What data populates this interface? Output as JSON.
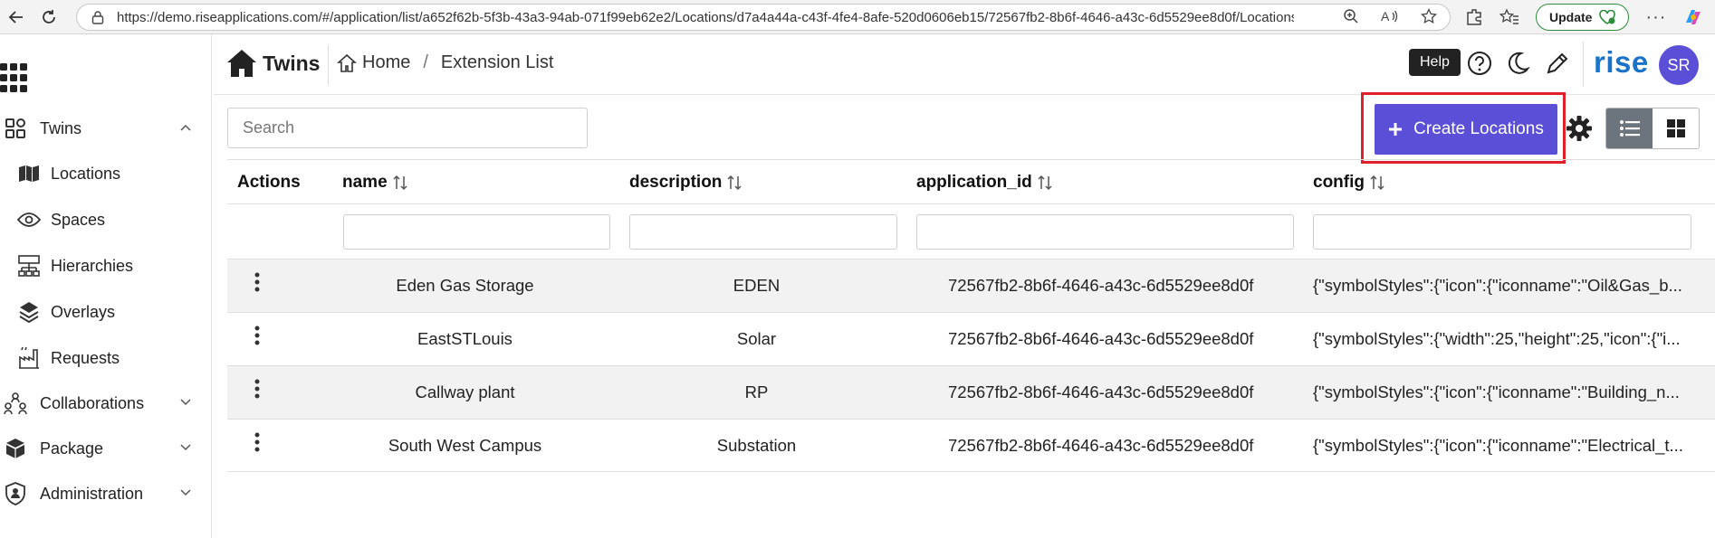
{
  "browser": {
    "url": "https://demo.riseapplications.com/#/application/list/a652f62b-5f3b-43a3-94ab-071f99eb62e2/Locations/d7a4a44a-c43f-4fe4-8afe-520d0606eb15/72567fb2-8b6f-4646-a43c-6d5529ee8d0f/Locations%...",
    "update_label": "Update"
  },
  "sidebar": {
    "items": [
      {
        "label": "Twins",
        "icon": "grid-squares-icon",
        "expandable": true,
        "expanded": true
      },
      {
        "label": "Locations",
        "icon": "map-icon"
      },
      {
        "label": "Spaces",
        "icon": "eye-icon"
      },
      {
        "label": "Hierarchies",
        "icon": "hierarchy-icon"
      },
      {
        "label": "Overlays",
        "icon": "layers-icon"
      },
      {
        "label": "Requests",
        "icon": "factory-icon"
      },
      {
        "label": "Collaborations",
        "icon": "people-icon",
        "expandable": true
      },
      {
        "label": "Package",
        "icon": "box-icon",
        "expandable": true
      },
      {
        "label": "Administration",
        "icon": "shield-user-icon",
        "expandable": true
      }
    ]
  },
  "header": {
    "app_title": "Twins",
    "breadcrumb": [
      "Home",
      "Extension List"
    ],
    "help_tooltip": "Help",
    "logo_text": "rise",
    "avatar_initials": "SR"
  },
  "toolbar": {
    "search_placeholder": "Search",
    "create_label": "Create Locations"
  },
  "table": {
    "columns": [
      "Actions",
      "name",
      "description",
      "application_id",
      "config"
    ],
    "rows": [
      {
        "name": "Eden Gas Storage",
        "description": "EDEN",
        "application_id": "72567fb2-8b6f-4646-a43c-6d5529ee8d0f",
        "config": "{\"symbolStyles\":{\"icon\":{\"iconname\":\"Oil&Gas_b..."
      },
      {
        "name": "EastSTLouis",
        "description": "Solar",
        "application_id": "72567fb2-8b6f-4646-a43c-6d5529ee8d0f",
        "config": "{\"symbolStyles\":{\"width\":25,\"height\":25,\"icon\":{\"i..."
      },
      {
        "name": "Callway plant",
        "description": "RP",
        "application_id": "72567fb2-8b6f-4646-a43c-6d5529ee8d0f",
        "config": "{\"symbolStyles\":{\"icon\":{\"iconname\":\"Building_n..."
      },
      {
        "name": "South West Campus",
        "description": "Substation",
        "application_id": "72567fb2-8b6f-4646-a43c-6d5529ee8d0f",
        "config": "{\"symbolStyles\":{\"icon\":{\"iconname\":\"Electrical_t..."
      }
    ]
  },
  "colors": {
    "accent": "#5a4fd6",
    "highlight": "#e0202a",
    "logo": "#1a73c8"
  }
}
